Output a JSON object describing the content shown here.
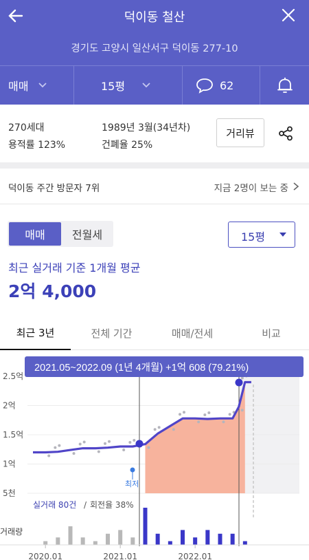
{
  "header": {
    "title": "덕이동 철산",
    "address": "경기도 고양시 일산서구 덕이동 277-10",
    "deal_type": "매매",
    "area": "15평",
    "comment_count": "62"
  },
  "info": {
    "households": "270세대",
    "floor_area_ratio": "용적률 123%",
    "built": "1989년 3월(34년차)",
    "coverage_ratio": "건폐율 25%",
    "review_button": "거리뷰"
  },
  "visit": {
    "rank_text": "덕이동 주간 방문자 7위",
    "viewing_now": "지금 2명이 보는 중"
  },
  "filters": {
    "segments": [
      "매매",
      "전월세"
    ],
    "area_select": "15평"
  },
  "summary": {
    "label": "최근 실거래 기준 1개월 평균",
    "value": "2억 4,000"
  },
  "tabs": [
    "최근 3년",
    "전체 기간",
    "매매/전세",
    "비교"
  ],
  "chart_data": {
    "type": "line",
    "tooltip": "2021.05~2022.09 (1년 4개월)  +1억 608 (79.21%)",
    "y_ticks": [
      "2.5억",
      "2억",
      "1.5억",
      "1억",
      "5천"
    ],
    "x_ticks": [
      "2020.01",
      "2021.01",
      "2022.01"
    ],
    "min_label": "최저",
    "trade_label": "실거래 80건",
    "turnover_label": "회전율 38%",
    "volume_label": "거래량",
    "ylim": [
      0.5,
      2.5
    ],
    "price_series": {
      "name": "price",
      "x": [
        "2019.11",
        "2020.01",
        "2020.03",
        "2020.05",
        "2020.07",
        "2020.09",
        "2020.11",
        "2021.01",
        "2021.03",
        "2021.05",
        "2021.07",
        "2021.09",
        "2021.11",
        "2022.01",
        "2022.03",
        "2022.05",
        "2022.07",
        "2022.08",
        "2022.09",
        "2022.10"
      ],
      "values": [
        1.2,
        1.2,
        1.21,
        1.24,
        1.27,
        1.27,
        1.28,
        1.3,
        1.3,
        1.34,
        1.52,
        1.65,
        1.78,
        1.78,
        1.77,
        1.78,
        1.78,
        1.98,
        2.4,
        2.4
      ]
    },
    "volume_series": {
      "name": "거래량",
      "x": [
        "2020.01",
        "2020.03",
        "2020.05",
        "2020.07",
        "2020.09",
        "2020.11",
        "2021.01",
        "2021.03",
        "2021.05",
        "2021.07",
        "2021.09",
        "2021.11",
        "2022.01",
        "2022.03",
        "2022.05",
        "2022.07",
        "2022.09"
      ],
      "values": [
        1,
        2,
        5,
        2,
        1,
        3,
        4,
        2,
        10,
        3,
        1,
        4,
        2,
        4,
        3,
        3,
        1
      ]
    },
    "colors": {
      "line": "#5045c8",
      "area": "#f7b39d",
      "volume_gray": "#b8b8b8",
      "volume_blue": "#3a37c8",
      "tooltip_bg": "#5a5fc6"
    }
  }
}
